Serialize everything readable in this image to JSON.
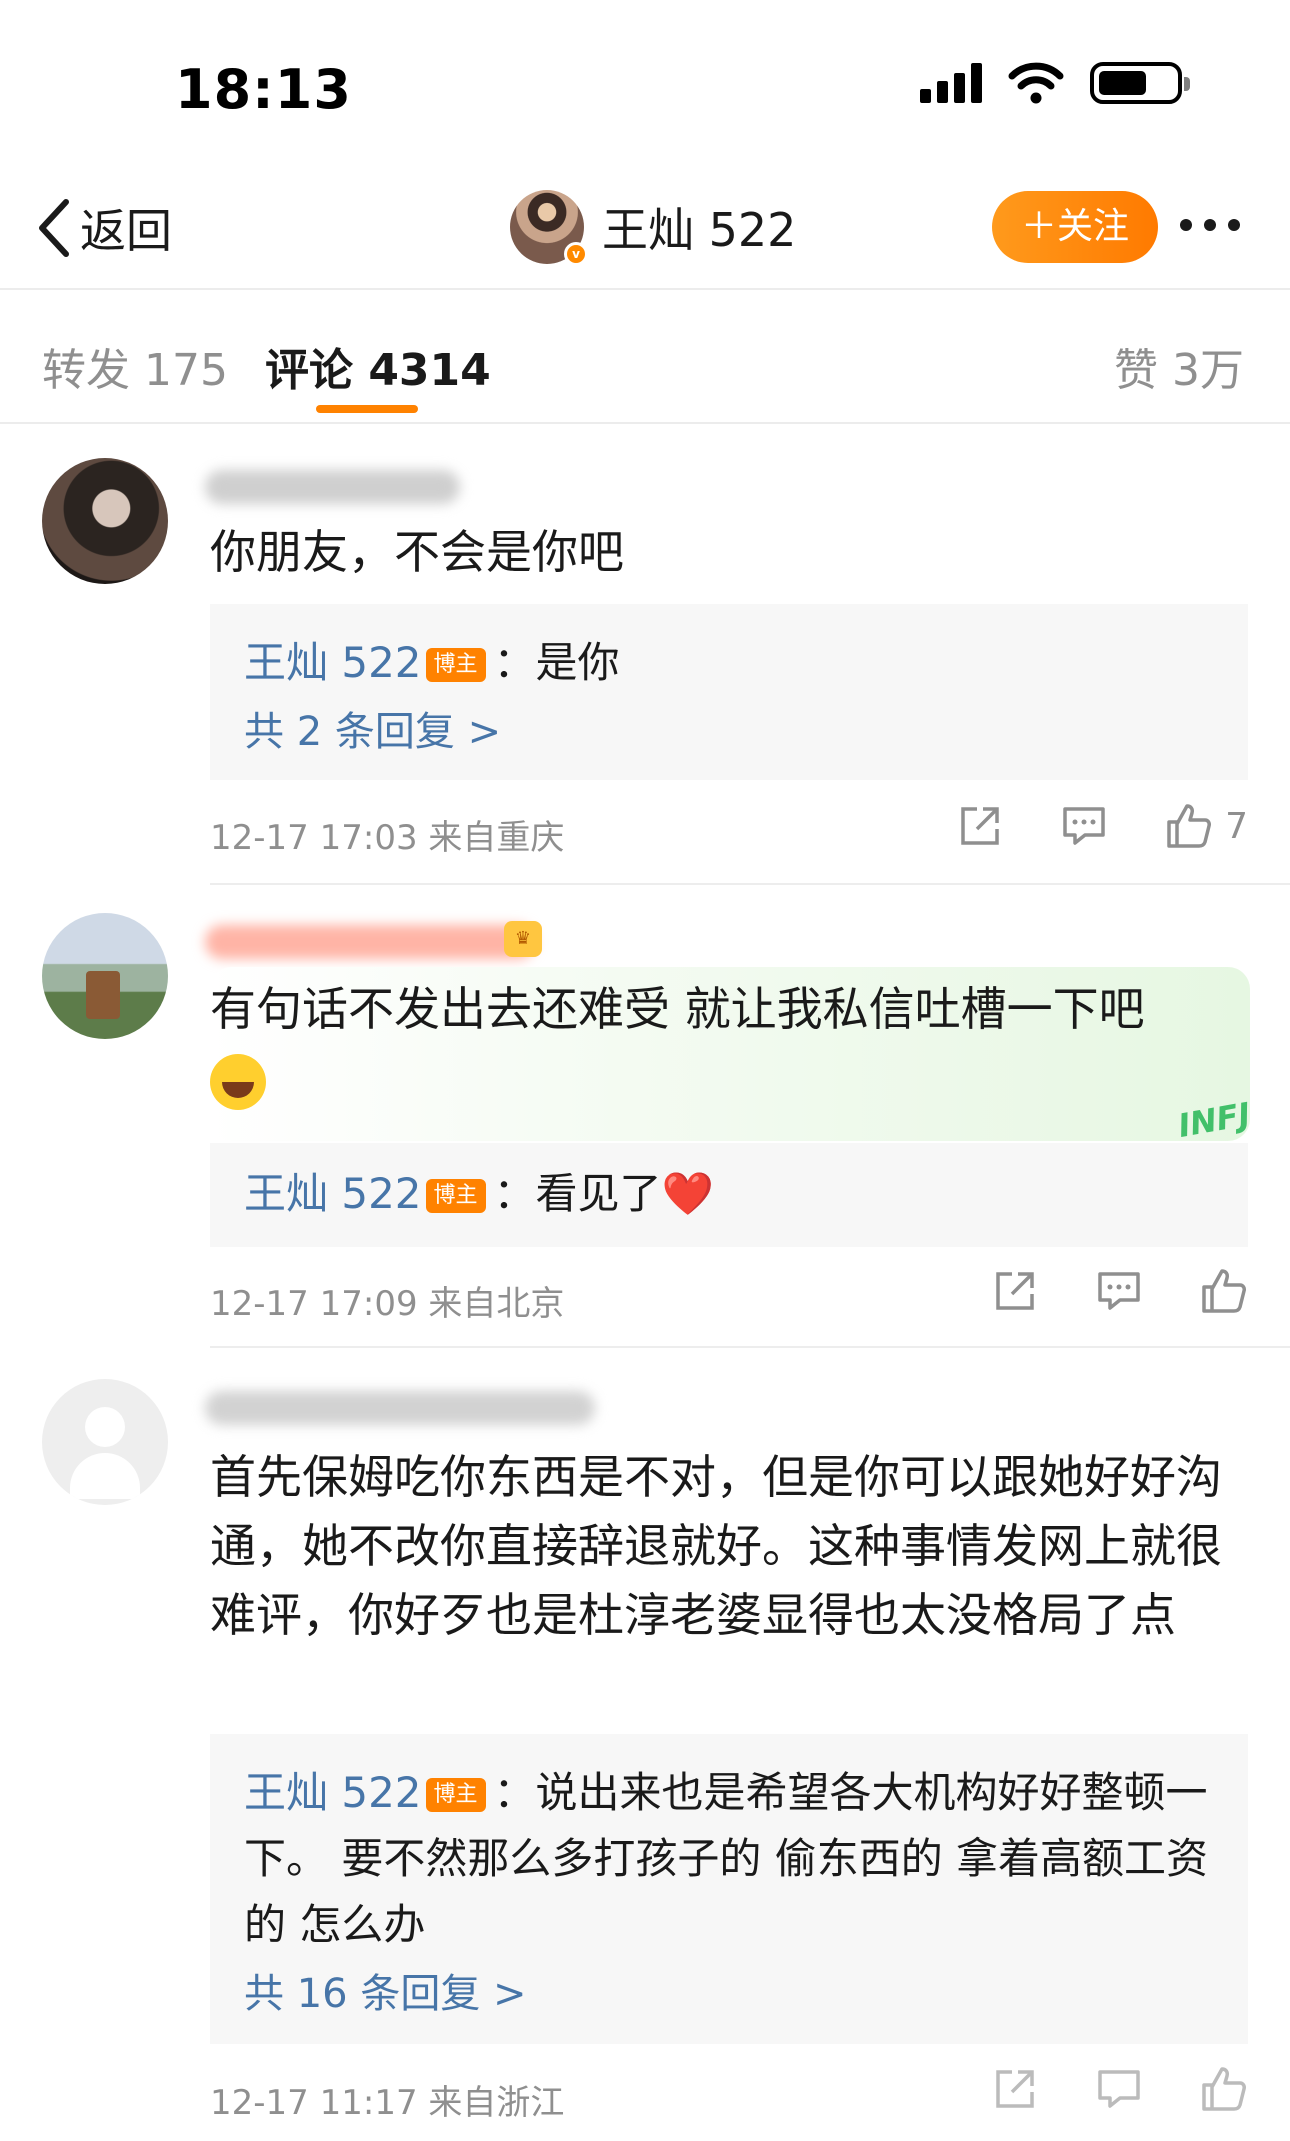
{
  "status_bar": {
    "time": "18:13"
  },
  "nav": {
    "back_label": "返回",
    "title": "王灿 522",
    "follow_label": "＋关注"
  },
  "tabs": {
    "repost": "转发 175",
    "comments": "评论 4314",
    "likes": "赞 3万"
  },
  "comments": [
    {
      "text": "你朋友，不会是你吧",
      "reply_author": "王灿 522",
      "reply_badge": "博主",
      "reply_text": "：是你",
      "reply_more": "共 2 条回复 >",
      "time_location": "12-17 17:03  来自重庆",
      "like_count": "7"
    },
    {
      "text": "有句话不发出去还难受 就让我私信吐槽一下吧",
      "reply_author": "王灿 522",
      "reply_badge": "博主",
      "reply_text": "：看见了",
      "reply_emoji": "❤️",
      "time_location": "12-17 17:09  来自北京"
    },
    {
      "text": "首先保姆吃你东西是不对，但是你可以跟她好好沟通，她不改你直接辞退就好。这种事情发网上就很难评，你好歹也是杜淳老婆显得也太没格局了点",
      "reply_author": "王灿 522",
      "reply_badge": "博主",
      "reply_text": "：说出来也是希望各大机构好好整顿一下。 要不然那么多打孩子的 偷东西的 拿着高额工资的 怎么办",
      "reply_more": "共 16 条回复 >",
      "time_location": "12-17 11:17  来自浙江"
    }
  ],
  "colors": {
    "accent": "#ff8200",
    "link_blue": "#4775a8",
    "reply_bg": "#f7f7f7",
    "meta_gray": "#8f8f8f"
  }
}
